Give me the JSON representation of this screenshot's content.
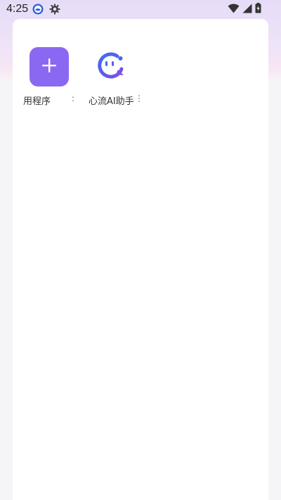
{
  "status_bar": {
    "time": "4:25",
    "left_icons": [
      "app-notification-icon",
      "gear-icon"
    ],
    "right_icons": [
      "wifi-icon",
      "cellular-signal-icon",
      "battery-charging-icon"
    ]
  },
  "apps": [
    {
      "label": "用程序",
      "more": ":",
      "icon": "plus-icon",
      "icon_bg": "#8b68f2"
    },
    {
      "label": "心流AI助手",
      "more": "⋮",
      "icon": "xinliu-logo-icon"
    }
  ],
  "colors": {
    "accent": "#8b68f2",
    "logo_blue": "#3b6cf2",
    "logo_purple": "#7b4fe8"
  }
}
